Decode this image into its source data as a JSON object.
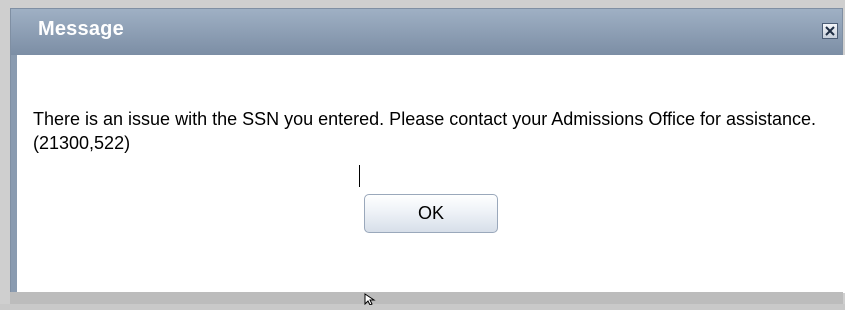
{
  "dialog": {
    "title": "Message",
    "close_icon": "close-icon",
    "message": "There is an issue with the SSN you entered. Please contact your Admissions Office for assistance. (21300,522)",
    "ok_label": "OK"
  },
  "colors": {
    "titlebar_top": "#9fb0c4",
    "titlebar_bottom": "#7c8ea5",
    "button_border": "#9aa8bb"
  }
}
